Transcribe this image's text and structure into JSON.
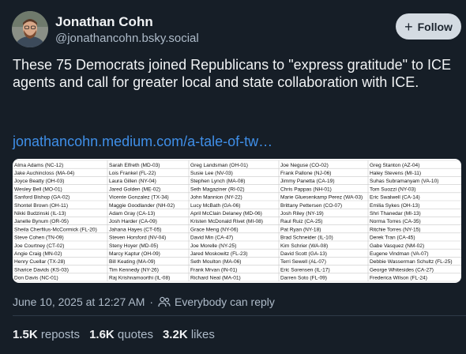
{
  "author": {
    "name": "Jonathan Cohn",
    "handle": "@jonathancohn.bsky.social"
  },
  "follow_button": {
    "label": "Follow",
    "icon": "plus-icon"
  },
  "post": {
    "text": "These 75 Democrats joined Republicans to \"express gratitude\" to ICE agents and call for greater local and state collaboration with ICE.",
    "link_text": "jonathancohn.medium.com/a-tale-of-tw…"
  },
  "embed": {
    "columns": [
      [
        "Alma Adams (NC-12)",
        "Jake Auchincloss (MA-04)",
        "Joyce Beatty (OH-03)",
        "Wesley Bell (MO-01)",
        "Sanford Bishop (GA-02)",
        "Shontel Brown (OH-11)",
        "Nikki Budzinski (IL-13)",
        "Janelle Bynum (OR-05)",
        "Sheila Cherfilus-McCormick (FL-20)",
        "Steve Cohen (TN-09)",
        "Joe Courtney (CT-02)",
        "Angie Craig (MN-02)",
        "Henry Cuellar (TX-28)",
        "Sharice Davids (KS-03)",
        "Don Davis (NC-01)"
      ],
      [
        "Sarah Elfreth (MD-03)",
        "Lois Frankel (FL-22)",
        "Laura Gillen (NY-04)",
        "Jared Golden (ME-02)",
        "Vicente Gonzalez (TX-34)",
        "Maggie Goodlander (NH-02)",
        "Adam Gray (CA-13)",
        "Josh Harder (CA-09)",
        "Jahana Hayes (CT-05)",
        "Steven Horsford (NV-04)",
        "Steny Hoyer (MD-05)",
        "Marcy Kaptur (OH-09)",
        "Bill Keating (MA-09)",
        "Tim Kennedy (NY-26)",
        "Raj Krishnamoorthi (IL-08)"
      ],
      [
        "Greg Landsman (OH-01)",
        "Susie Lee (NV-03)",
        "Stephen Lynch (MA-08)",
        "Seth Magaziner (RI-02)",
        "John Mannion (NY-22)",
        "Lucy McBath (GA-06)",
        "April McClain Delaney (MD-06)",
        "Kristen McDonald Rivet (MI-08)",
        "Grace Meng (NY-06)",
        "David Min (CA-47)",
        "Joe Morelle (NY-25)",
        "Jared Moskowitz (FL-23)",
        "Seth Moulton (MA-06)",
        "Frank Mrvan (IN-01)",
        "Richard Neal (MA-01)"
      ],
      [
        "Joe Neguse (CO-02)",
        "Frank Pallone (NJ-06)",
        "Jimmy Panetta (CA-19)",
        "Chris Pappas (NH-01)",
        "Marie Gluesenkamp Perez (WA-03)",
        "Brittany Pettersen (CO-07)",
        "Josh Riley (NY-19)",
        "Raul Ruiz (CA-25)",
        "Pat Ryan (NY-18)",
        "Brad Schneider (IL-10)",
        "Kim Schrier (WA-08)",
        "David Scott (GA-13)",
        "Terri Sewell (AL-07)",
        "Eric Sorensen (IL-17)",
        "Darren Soto (FL-09)"
      ],
      [
        "Greg Stanton (AZ-04)",
        "Haley Stevens (MI-11)",
        "Suhas Subramanyam (VA-10)",
        "Tom Suozzi (NY-03)",
        "Eric Swalwell (CA-14)",
        "Emilia Sykes (OH-13)",
        "Shri Thanedar (MI-13)",
        "Norma Torres (CA-35)",
        "Ritchie Torres (NY-15)",
        "Derek Tran (CA-45)",
        "Gabe Vasquez (NM-02)",
        "Eugene Vindman (VA-07)",
        "Debbie Wasserman Schultz (FL-25)",
        "George Whitesides (CA-27)",
        "Frederica Wilson (FL-24)"
      ]
    ]
  },
  "meta": {
    "date": "June 10, 2025 at 12:27 AM",
    "separator": "·",
    "audience": "Everybody can reply",
    "audience_icon": "people-icon"
  },
  "stats": {
    "reposts_count": "1.5K",
    "reposts_label": "reposts",
    "quotes_count": "1.6K",
    "quotes_label": "quotes",
    "likes_count": "3.2K",
    "likes_label": "likes"
  }
}
